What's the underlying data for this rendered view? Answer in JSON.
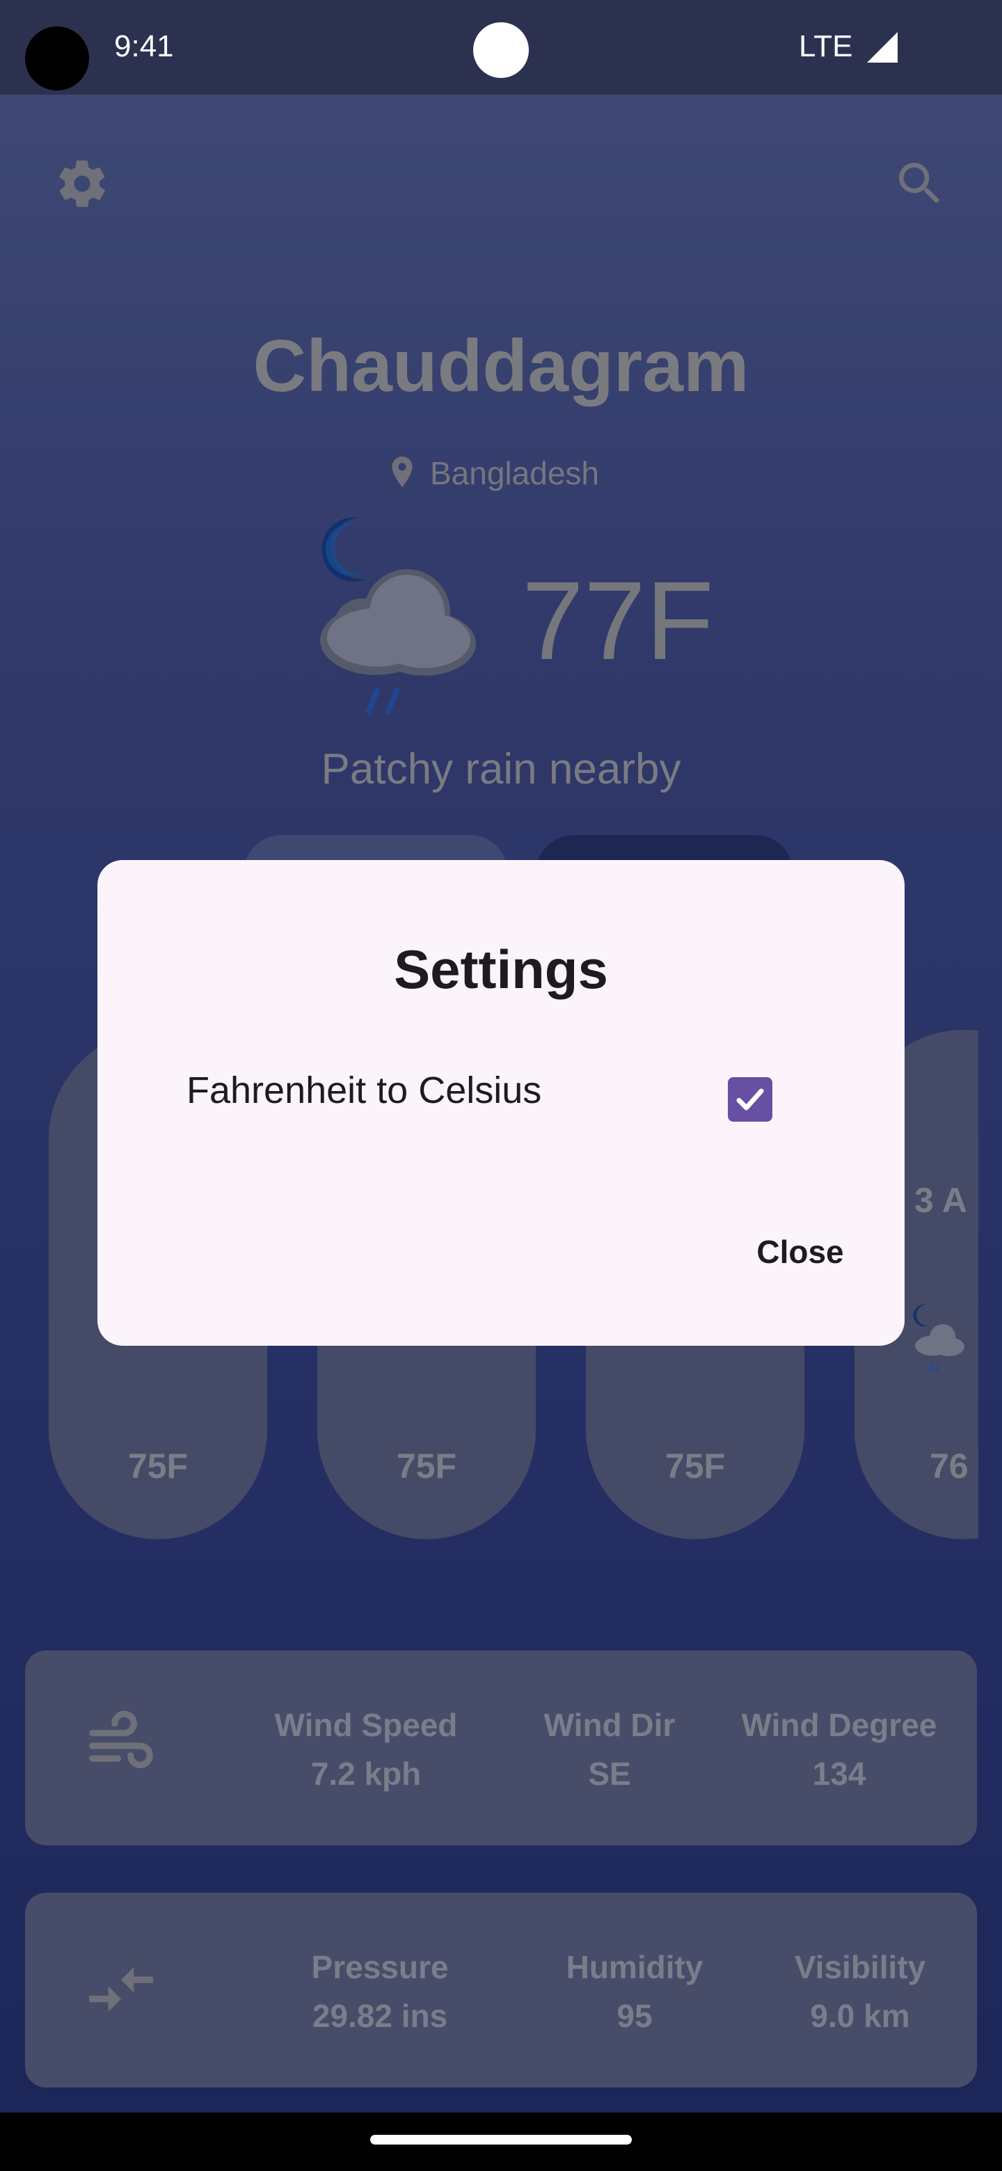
{
  "status_bar": {
    "time": "9:41",
    "network": "LTE"
  },
  "weather": {
    "city": "Chauddagram",
    "country": "Bangladesh",
    "temperature": "77F",
    "condition": "Patchy rain nearby"
  },
  "hourly": [
    {
      "time": "",
      "temp": "75F"
    },
    {
      "time": "",
      "temp": "75F"
    },
    {
      "time": "",
      "temp": "75F"
    },
    {
      "time": "3 A",
      "temp": "76"
    }
  ],
  "wind": {
    "speed_label": "Wind Speed",
    "speed_value": "7.2 kph",
    "dir_label": "Wind Dir",
    "dir_value": "SE",
    "degree_label": "Wind Degree",
    "degree_value": "134"
  },
  "atmosphere": {
    "pressure_label": "Pressure",
    "pressure_value": "29.82 ins",
    "humidity_label": "Humidity",
    "humidity_value": "95",
    "visibility_label": "Visibility",
    "visibility_value": "9.0 km"
  },
  "dialog": {
    "title": "Settings",
    "option_label": "Fahrenheit to Celsius",
    "option_checked": true,
    "close_label": "Close"
  },
  "colors": {
    "accent": "#6750a4",
    "dialog_bg": "#fcf4fb"
  },
  "icons": {
    "settings": "gear-icon",
    "search": "search-icon",
    "location": "location-pin-icon",
    "weather": "night-rain-cloud-icon",
    "wind": "wind-icon",
    "pressure": "pressure-arrows-icon"
  }
}
